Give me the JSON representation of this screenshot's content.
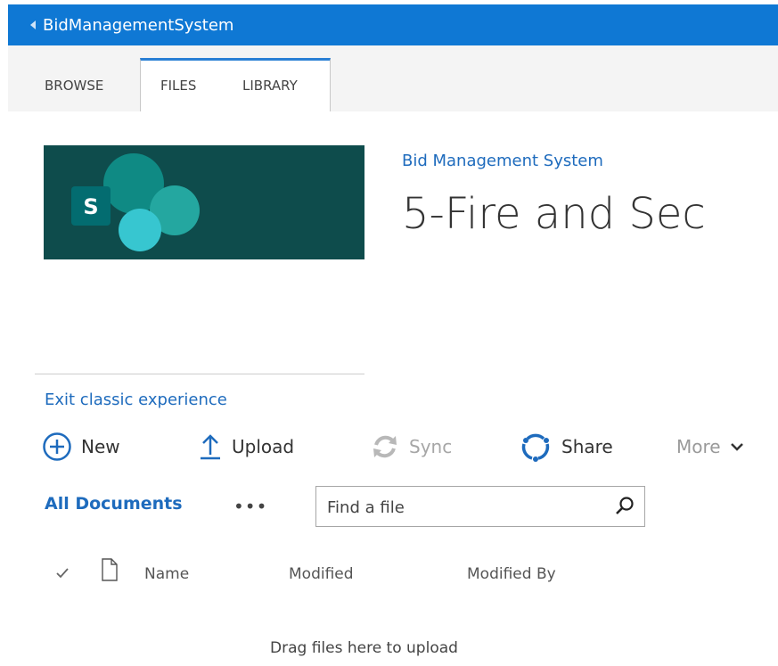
{
  "topbar": {
    "title": "BidManagementSystem"
  },
  "ribbon": {
    "tabs": [
      {
        "label": "BROWSE"
      },
      {
        "label": "FILES"
      },
      {
        "label": "LIBRARY"
      }
    ]
  },
  "site": {
    "logo_letter": "S",
    "breadcrumb": "Bid Management System",
    "page_title": "5-Fire and Sec"
  },
  "nav": {
    "exit_classic": "Exit classic experience"
  },
  "commands": {
    "new": "New",
    "upload": "Upload",
    "sync": "Sync",
    "share": "Share",
    "more": "More"
  },
  "view": {
    "current": "All Documents",
    "overflow": "•••",
    "search_placeholder": "Find a file"
  },
  "columns": {
    "name": "Name",
    "modified": "Modified",
    "modified_by": "Modified By"
  },
  "list": {
    "empty_message": "Drag files here to upload"
  },
  "colors": {
    "suite_bar": "#0f78d4",
    "link": "#1e6bbd",
    "logo_bg": "#0e4c4c",
    "ribbon_bg": "#f4f4f4"
  }
}
